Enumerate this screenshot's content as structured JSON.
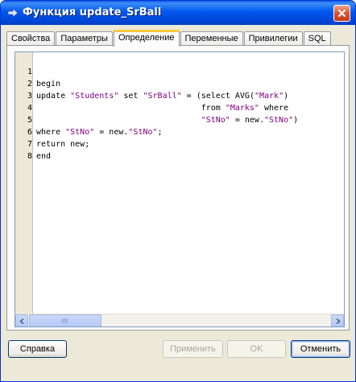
{
  "window": {
    "title": "Функция update_SrBall"
  },
  "tabs": [
    {
      "label": "Свойства"
    },
    {
      "label": "Параметры"
    },
    {
      "label": "Определение",
      "active": true
    },
    {
      "label": "Переменные"
    },
    {
      "label": "Привилегии"
    },
    {
      "label": "SQL"
    }
  ],
  "editor": {
    "line_numbers": [
      "1",
      "2",
      "3",
      "4",
      "5",
      "6",
      "7",
      "8"
    ]
  },
  "buttons": {
    "help": "Справка",
    "apply": "Применить",
    "ok": "OK",
    "cancel": "Отменить"
  },
  "colors": {
    "title_bar": "#0054e3",
    "active_tab_highlight": "#ffc83c",
    "string_literal": "#800080",
    "gutter": "#ece9d8"
  },
  "icons": {
    "title": "arrow-icon",
    "close": "close-icon",
    "scroll_left": "chevron-left-icon",
    "scroll_right": "chevron-right-icon"
  }
}
